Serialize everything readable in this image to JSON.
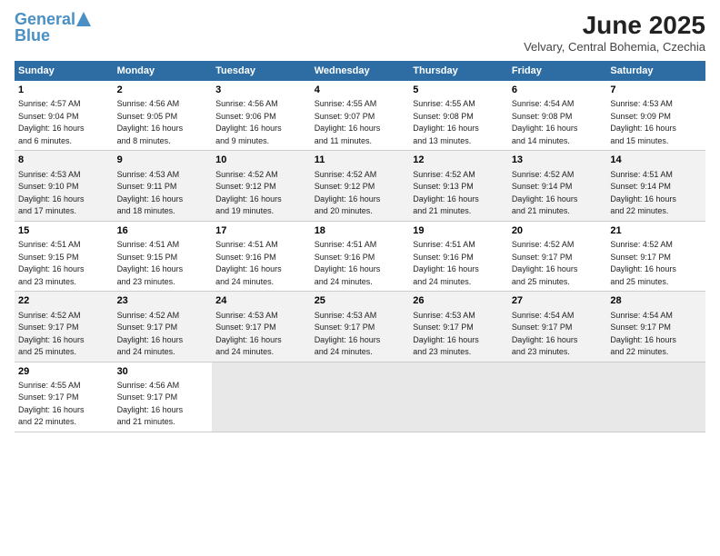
{
  "logo": {
    "line1": "General",
    "line2": "Blue"
  },
  "title": {
    "month_year": "June 2025",
    "location": "Velvary, Central Bohemia, Czechia"
  },
  "columns": [
    "Sunday",
    "Monday",
    "Tuesday",
    "Wednesday",
    "Thursday",
    "Friday",
    "Saturday"
  ],
  "weeks": [
    [
      {
        "day": "1",
        "info": "Sunrise: 4:57 AM\nSunset: 9:04 PM\nDaylight: 16 hours\nand 6 minutes."
      },
      {
        "day": "2",
        "info": "Sunrise: 4:56 AM\nSunset: 9:05 PM\nDaylight: 16 hours\nand 8 minutes."
      },
      {
        "day": "3",
        "info": "Sunrise: 4:56 AM\nSunset: 9:06 PM\nDaylight: 16 hours\nand 9 minutes."
      },
      {
        "day": "4",
        "info": "Sunrise: 4:55 AM\nSunset: 9:07 PM\nDaylight: 16 hours\nand 11 minutes."
      },
      {
        "day": "5",
        "info": "Sunrise: 4:55 AM\nSunset: 9:08 PM\nDaylight: 16 hours\nand 13 minutes."
      },
      {
        "day": "6",
        "info": "Sunrise: 4:54 AM\nSunset: 9:08 PM\nDaylight: 16 hours\nand 14 minutes."
      },
      {
        "day": "7",
        "info": "Sunrise: 4:53 AM\nSunset: 9:09 PM\nDaylight: 16 hours\nand 15 minutes."
      }
    ],
    [
      {
        "day": "8",
        "info": "Sunrise: 4:53 AM\nSunset: 9:10 PM\nDaylight: 16 hours\nand 17 minutes."
      },
      {
        "day": "9",
        "info": "Sunrise: 4:53 AM\nSunset: 9:11 PM\nDaylight: 16 hours\nand 18 minutes."
      },
      {
        "day": "10",
        "info": "Sunrise: 4:52 AM\nSunset: 9:12 PM\nDaylight: 16 hours\nand 19 minutes."
      },
      {
        "day": "11",
        "info": "Sunrise: 4:52 AM\nSunset: 9:12 PM\nDaylight: 16 hours\nand 20 minutes."
      },
      {
        "day": "12",
        "info": "Sunrise: 4:52 AM\nSunset: 9:13 PM\nDaylight: 16 hours\nand 21 minutes."
      },
      {
        "day": "13",
        "info": "Sunrise: 4:52 AM\nSunset: 9:14 PM\nDaylight: 16 hours\nand 21 minutes."
      },
      {
        "day": "14",
        "info": "Sunrise: 4:51 AM\nSunset: 9:14 PM\nDaylight: 16 hours\nand 22 minutes."
      }
    ],
    [
      {
        "day": "15",
        "info": "Sunrise: 4:51 AM\nSunset: 9:15 PM\nDaylight: 16 hours\nand 23 minutes."
      },
      {
        "day": "16",
        "info": "Sunrise: 4:51 AM\nSunset: 9:15 PM\nDaylight: 16 hours\nand 23 minutes."
      },
      {
        "day": "17",
        "info": "Sunrise: 4:51 AM\nSunset: 9:16 PM\nDaylight: 16 hours\nand 24 minutes."
      },
      {
        "day": "18",
        "info": "Sunrise: 4:51 AM\nSunset: 9:16 PM\nDaylight: 16 hours\nand 24 minutes."
      },
      {
        "day": "19",
        "info": "Sunrise: 4:51 AM\nSunset: 9:16 PM\nDaylight: 16 hours\nand 24 minutes."
      },
      {
        "day": "20",
        "info": "Sunrise: 4:52 AM\nSunset: 9:17 PM\nDaylight: 16 hours\nand 25 minutes."
      },
      {
        "day": "21",
        "info": "Sunrise: 4:52 AM\nSunset: 9:17 PM\nDaylight: 16 hours\nand 25 minutes."
      }
    ],
    [
      {
        "day": "22",
        "info": "Sunrise: 4:52 AM\nSunset: 9:17 PM\nDaylight: 16 hours\nand 25 minutes."
      },
      {
        "day": "23",
        "info": "Sunrise: 4:52 AM\nSunset: 9:17 PM\nDaylight: 16 hours\nand 24 minutes."
      },
      {
        "day": "24",
        "info": "Sunrise: 4:53 AM\nSunset: 9:17 PM\nDaylight: 16 hours\nand 24 minutes."
      },
      {
        "day": "25",
        "info": "Sunrise: 4:53 AM\nSunset: 9:17 PM\nDaylight: 16 hours\nand 24 minutes."
      },
      {
        "day": "26",
        "info": "Sunrise: 4:53 AM\nSunset: 9:17 PM\nDaylight: 16 hours\nand 23 minutes."
      },
      {
        "day": "27",
        "info": "Sunrise: 4:54 AM\nSunset: 9:17 PM\nDaylight: 16 hours\nand 23 minutes."
      },
      {
        "day": "28",
        "info": "Sunrise: 4:54 AM\nSunset: 9:17 PM\nDaylight: 16 hours\nand 22 minutes."
      }
    ],
    [
      {
        "day": "29",
        "info": "Sunrise: 4:55 AM\nSunset: 9:17 PM\nDaylight: 16 hours\nand 22 minutes."
      },
      {
        "day": "30",
        "info": "Sunrise: 4:56 AM\nSunset: 9:17 PM\nDaylight: 16 hours\nand 21 minutes."
      },
      {
        "day": "",
        "info": ""
      },
      {
        "day": "",
        "info": ""
      },
      {
        "day": "",
        "info": ""
      },
      {
        "day": "",
        "info": ""
      },
      {
        "day": "",
        "info": ""
      }
    ]
  ]
}
